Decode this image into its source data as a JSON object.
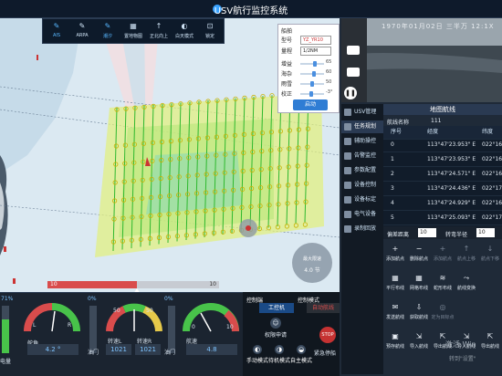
{
  "app": {
    "title": "USV航行监控系统"
  },
  "map_toolbar": [
    {
      "label": "AIS",
      "icon": "pen-icon",
      "active": true
    },
    {
      "label": "ARPA",
      "icon": "pen-icon",
      "active": false
    },
    {
      "label": "潮汐",
      "icon": "pen-icon",
      "active": true
    },
    {
      "label": "置地物图",
      "icon": "layers-icon",
      "active": false
    },
    {
      "label": "正北向上",
      "icon": "north-up-icon",
      "active": false
    },
    {
      "label": "白天模式",
      "icon": "half-circle-icon",
      "active": false
    },
    {
      "label": "锁定",
      "icon": "lock-icon",
      "active": false
    }
  ],
  "vessel_panel": {
    "heading": "船舶",
    "type_label": "型号",
    "type_value": "YZ_YR10",
    "scale_label": "量程",
    "scale_value": "1/2NM",
    "sliders": [
      {
        "label": "增益",
        "value": "65",
        "level": 0.65
      },
      {
        "label": "海杂",
        "value": "60",
        "level": 0.6
      },
      {
        "label": "雨雪",
        "value": "50",
        "level": 0.5
      },
      {
        "label": "校正",
        "value": "-3°",
        "level": 0.45
      }
    ],
    "start_label": "启动"
  },
  "map": {
    "label_heading": "艏向:",
    "speed_dial": {
      "label": "最大限速",
      "value": "4.0 节"
    },
    "progress": {
      "left_label": "10",
      "right_label": "10",
      "fill": 0.52
    }
  },
  "dashboard": {
    "battery": {
      "label": "电量",
      "value": "71%",
      "level": 0.71
    },
    "rudder": {
      "label": "舵角",
      "value": "4.2 °",
      "L": "L",
      "R": "R"
    },
    "throttle_left": {
      "label": "油门",
      "value": "0%",
      "level": 0.0
    },
    "rpm": {
      "label_l": "转速L",
      "value_l": "1021",
      "label_r": "转速R",
      "value_r": "1021",
      "ticks": [
        "50",
        "50"
      ]
    },
    "throttle_right": {
      "label": "油门",
      "value": "0%",
      "level": 0.0
    },
    "speed": {
      "label": "航速",
      "value": "4.8",
      "ticks": [
        "0",
        "10"
      ]
    }
  },
  "control": {
    "header_left": "控制端",
    "header_right": "控制模式",
    "ctrl_station": "工控机",
    "auto_route": "自动航线",
    "request": "权限申请",
    "stop": "STOP",
    "stop_label": "紧急停船",
    "modes": [
      "手动模式",
      "待机模式",
      "自主模式"
    ]
  },
  "video": {
    "timestamp": "1970年01月02日 三半万 12:1X"
  },
  "side_menu": [
    {
      "label": "USV管理",
      "active": false
    },
    {
      "label": "任务规划",
      "active": true
    },
    {
      "label": "辅助操控",
      "active": false
    },
    {
      "label": "告警监控",
      "active": false
    },
    {
      "label": "参数配置",
      "active": false
    },
    {
      "label": "设备控制",
      "active": false
    },
    {
      "label": "设备标定",
      "active": false
    },
    {
      "label": "电气设备",
      "active": false
    },
    {
      "label": "录制回放",
      "active": false
    }
  ],
  "route": {
    "title": "地图航线",
    "name_label": "航线名称",
    "name_value": "111",
    "columns": [
      "序号",
      "经度",
      "纬度"
    ],
    "rows": [
      {
        "idx": "0",
        "lon": "113°47'23.953\" E",
        "lat": "022°16"
      },
      {
        "idx": "1",
        "lon": "113°47'23.953\" E",
        "lat": "022°16"
      },
      {
        "idx": "2",
        "lon": "113°47'24.571\" E",
        "lat": "022°16"
      },
      {
        "idx": "3",
        "lon": "113°47'24.436\" E",
        "lat": "022°17"
      },
      {
        "idx": "4",
        "lon": "113°47'24.929\" E",
        "lat": "022°16"
      },
      {
        "idx": "5",
        "lon": "113°47'25.093\" E",
        "lat": "022°17"
      }
    ],
    "deviation_label": "偏差距离",
    "deviation_value": "10",
    "turn_label": "转弯半径",
    "turn_value": "10"
  },
  "route_buttons": [
    [
      {
        "label": "添加航点",
        "icon": "plus-icon",
        "disabled": false
      },
      {
        "label": "删除航点",
        "icon": "minus-icon",
        "disabled": false
      },
      {
        "label": "添加航点",
        "icon": "plus-icon",
        "disabled": true
      },
      {
        "label": "航点上移",
        "icon": "up-icon",
        "disabled": true
      },
      {
        "label": "航点下移",
        "icon": "down-icon",
        "disabled": true
      }
    ],
    [
      {
        "label": "平行布线",
        "icon": "grid-icon",
        "disabled": false
      },
      {
        "label": "网格布线",
        "icon": "grid-icon",
        "disabled": false
      },
      {
        "label": "蛇形布线",
        "icon": "snake-icon",
        "disabled": false
      },
      {
        "label": "航线变换",
        "icon": "route-icon",
        "disabled": false
      }
    ],
    [
      {
        "label": "发送航线",
        "icon": "send-icon",
        "disabled": false
      },
      {
        "label": "获取航线",
        "icon": "download-icon",
        "disabled": false
      },
      {
        "label": "定为目标点",
        "icon": "target-icon",
        "disabled": true
      }
    ],
    [
      {
        "label": "预存航线",
        "icon": "save-icon",
        "disabled": false
      },
      {
        "label": "导入航线",
        "icon": "import-icon",
        "disabled": false
      },
      {
        "label": "导出航线",
        "icon": "export-icon",
        "disabled": false
      },
      {
        "label": "导入航线",
        "icon": "import-icon",
        "disabled": false
      },
      {
        "label": "导出航线",
        "icon": "export-icon",
        "disabled": false
      }
    ]
  ],
  "watermark": {
    "line1": "激活 Win",
    "line2": "转到\"设置\""
  },
  "colors": {
    "accent": "#58b7ff",
    "danger": "#d94c4c",
    "route": "#c8b200",
    "track": "#2eb82e"
  }
}
